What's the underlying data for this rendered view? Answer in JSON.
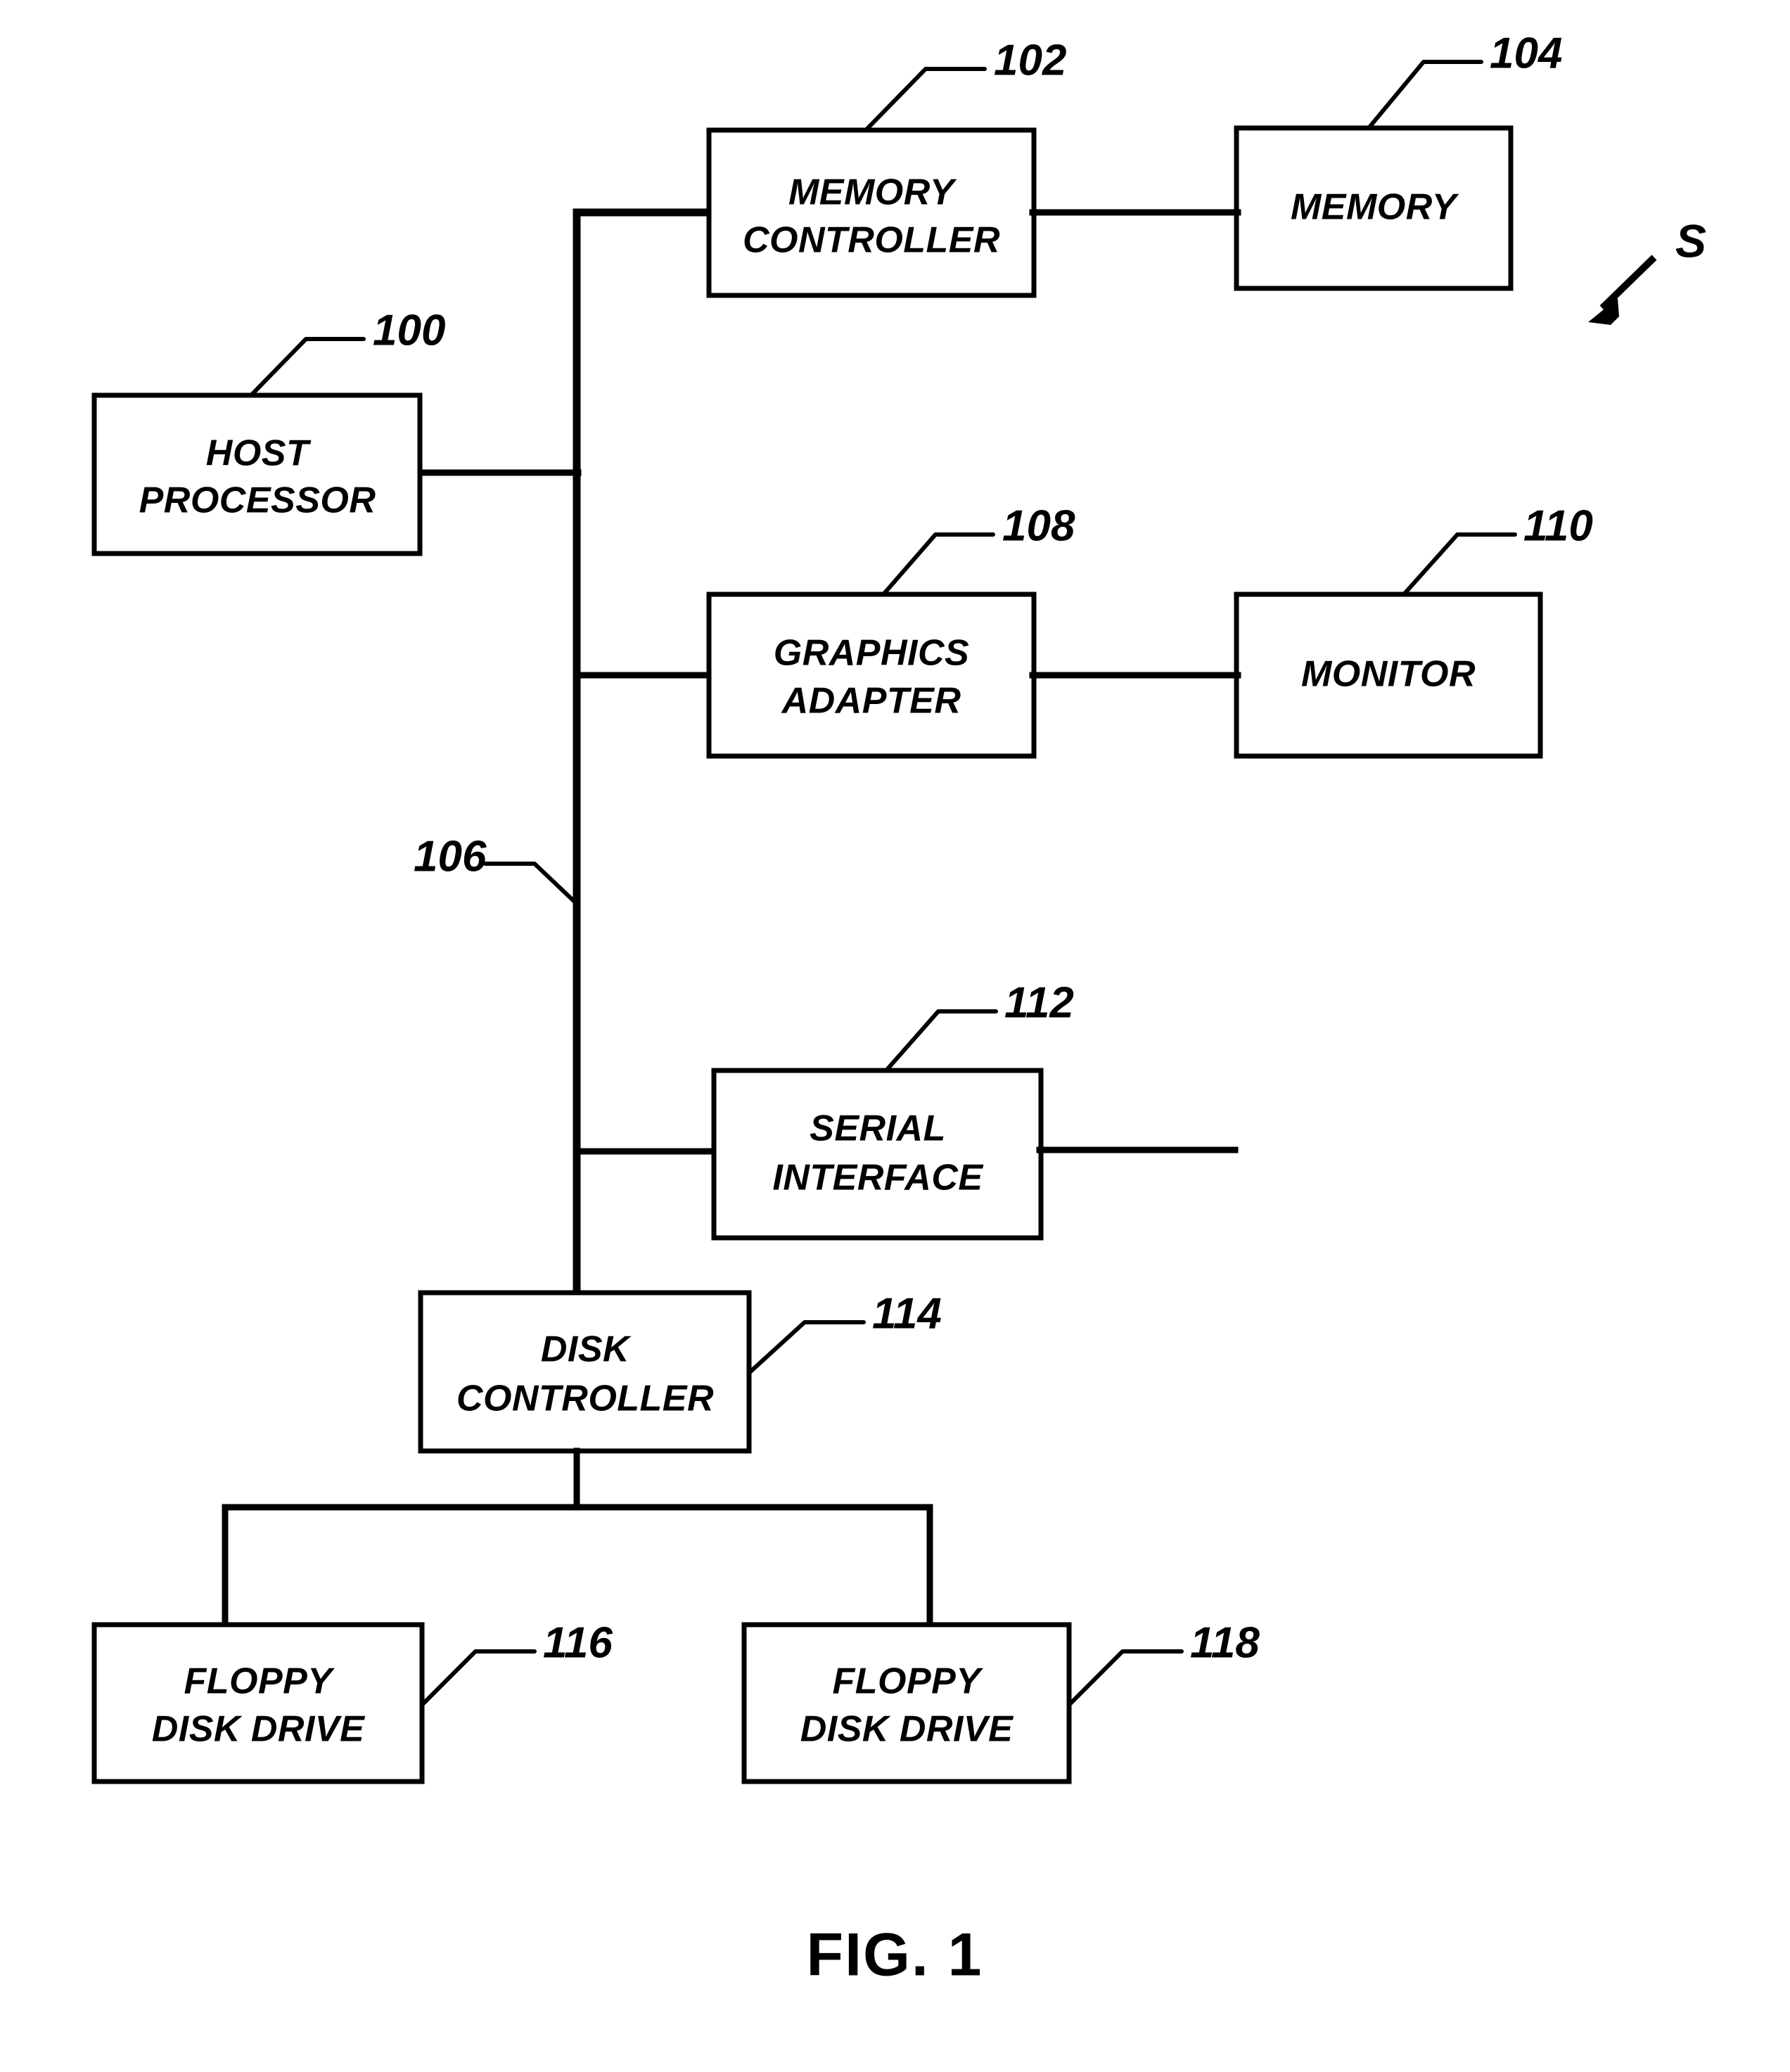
{
  "figure": {
    "caption": "FIG. 1",
    "system_label": "S",
    "background_color": "#ffffff",
    "line_color": "#000000"
  },
  "nodes": [
    {
      "id": "host-processor",
      "ref": "100",
      "lines": [
        "HOST",
        "PROCESSOR"
      ],
      "line1": "HOST",
      "line2": "PROCESSOR"
    },
    {
      "id": "memory-controller",
      "ref": "102",
      "lines": [
        "MEMORY",
        "CONTROLLER"
      ],
      "line1": "MEMORY",
      "line2": "CONTROLLER"
    },
    {
      "id": "memory",
      "ref": "104",
      "lines": [
        "MEMORY"
      ],
      "line1": "MEMORY",
      "line2": ""
    },
    {
      "id": "graphics-adapter",
      "ref": "108",
      "lines": [
        "GRAPHICS",
        "ADAPTER"
      ],
      "line1": "GRAPHICS",
      "line2": "ADAPTER"
    },
    {
      "id": "monitor",
      "ref": "110",
      "lines": [
        "MONITOR"
      ],
      "line1": "MONITOR",
      "line2": ""
    },
    {
      "id": "serial-interface",
      "ref": "112",
      "lines": [
        "SERIAL",
        "INTERFACE"
      ],
      "line1": "SERIAL",
      "line2": "INTERFACE"
    },
    {
      "id": "disk-controller",
      "ref": "114",
      "lines": [
        "DISK",
        "CONTROLLER"
      ],
      "line1": "DISK",
      "line2": "CONTROLLER"
    },
    {
      "id": "floppy-disk-drive-1",
      "ref": "116",
      "lines": [
        "FLOPPY",
        "DISK DRIVE"
      ],
      "line1": "FLOPPY",
      "line2": "DISK DRIVE"
    },
    {
      "id": "floppy-disk-drive-2",
      "ref": "118",
      "lines": [
        "FLOPPY",
        "DISK DRIVE"
      ],
      "line1": "FLOPPY",
      "line2": "DISK DRIVE"
    }
  ],
  "bus": {
    "ref": "106",
    "name": "system bus"
  },
  "connections": [
    {
      "from": "host-processor",
      "to": "bus"
    },
    {
      "from": "bus",
      "to": "memory-controller"
    },
    {
      "from": "memory-controller",
      "to": "memory"
    },
    {
      "from": "bus",
      "to": "graphics-adapter"
    },
    {
      "from": "graphics-adapter",
      "to": "monitor"
    },
    {
      "from": "bus",
      "to": "serial-interface"
    },
    {
      "from": "serial-interface",
      "to": "external-serial-port"
    },
    {
      "from": "bus",
      "to": "disk-controller"
    },
    {
      "from": "disk-controller",
      "to": "floppy-disk-drive-1"
    },
    {
      "from": "disk-controller",
      "to": "floppy-disk-drive-2"
    }
  ]
}
